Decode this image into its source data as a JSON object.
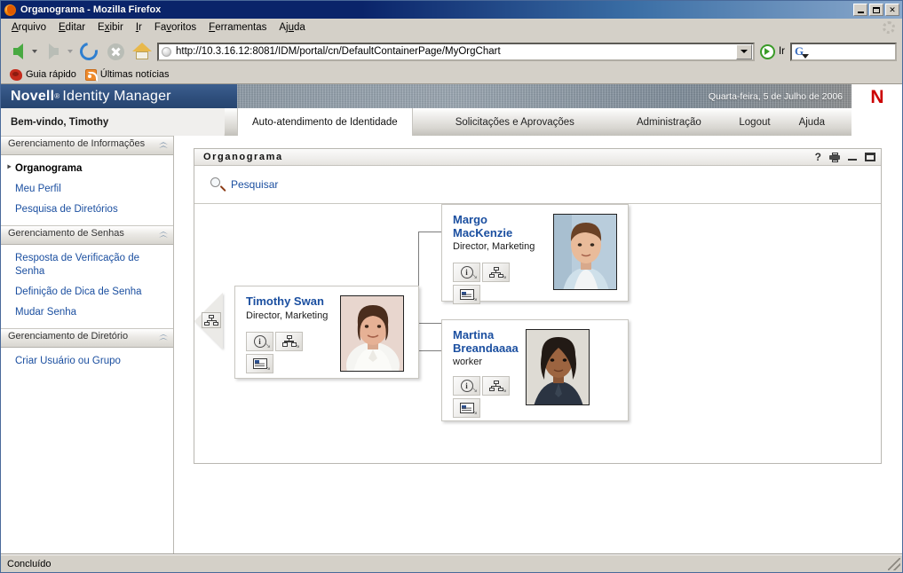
{
  "window": {
    "title": "Organograma - Mozilla Firefox",
    "app_icon": "firefox-icon",
    "minimize_label": "",
    "maximize_label": "",
    "close_label": "✕"
  },
  "menubar": {
    "items": [
      {
        "label": "Arquivo",
        "accel": "A"
      },
      {
        "label": "Editar",
        "accel": "E"
      },
      {
        "label": "Exibir",
        "accel": "x"
      },
      {
        "label": "Ir",
        "accel": "I"
      },
      {
        "label": "Favoritos",
        "accel": "v"
      },
      {
        "label": "Ferramentas",
        "accel": "F"
      },
      {
        "label": "Ajuda",
        "accel": "u"
      }
    ]
  },
  "toolbar": {
    "back_icon": "back-arrow-icon",
    "forward_icon": "forward-arrow-icon",
    "reload_icon": "reload-icon",
    "stop_icon": "stop-icon",
    "home_icon": "home-icon",
    "url": "http://10.3.16.12:8081/IDM/portal/cn/DefaultContainerPage/MyOrgChart",
    "url_placeholder": "",
    "go_label": "Ir",
    "search_value": "",
    "search_placeholder": "",
    "search_engine_icon": "google-g-icon"
  },
  "bookmarks": [
    {
      "label": "Guia rápido",
      "icon": "firefox-bookmark-icon"
    },
    {
      "label": "Últimas notícias",
      "icon": "rss-feed-icon"
    }
  ],
  "novell": {
    "brand_name": "Novell",
    "brand_reg": "®",
    "brand_product": "Identity Manager",
    "date": "Quarta-feira, 5 de Julho de 2006",
    "logo_letter": "N",
    "logo_color": "#cc0000",
    "welcome": "Bem-vindo, Timothy"
  },
  "tabs": [
    {
      "label": "Auto-atendimento de Identidade",
      "active": true
    },
    {
      "label": "Solicitações e Aprovações",
      "active": false
    },
    {
      "label": "Administração",
      "active": false
    },
    {
      "label": "Logout",
      "active": false
    },
    {
      "label": "Ajuda",
      "active": false
    }
  ],
  "sidebar": {
    "sections": [
      {
        "title": "Gerenciamento de Informações",
        "collapse_icon": "chevron-up-icon",
        "links": [
          {
            "label": "Organograma",
            "active": true
          },
          {
            "label": "Meu Perfil",
            "active": false
          },
          {
            "label": "Pesquisa de Diretórios",
            "active": false
          }
        ]
      },
      {
        "title": "Gerenciamento de Senhas",
        "collapse_icon": "chevron-up-icon",
        "links": [
          {
            "label": "Resposta de Verificação de Senha",
            "active": false
          },
          {
            "label": "Definição de Dica de Senha",
            "active": false
          },
          {
            "label": "Mudar Senha",
            "active": false
          }
        ]
      },
      {
        "title": "Gerenciamento de Diretório",
        "collapse_icon": "chevron-up-icon",
        "links": [
          {
            "label": "Criar Usuário ou Grupo",
            "active": false
          }
        ]
      }
    ]
  },
  "portlet": {
    "title": "Organograma",
    "controls": [
      {
        "name": "help-icon",
        "label": "?"
      },
      {
        "name": "print-icon",
        "label": ""
      },
      {
        "name": "minimize-icon",
        "label": ""
      },
      {
        "name": "maximize-icon",
        "label": ""
      }
    ],
    "search_icon": "magnifier-icon",
    "search_label": "Pesquisar"
  },
  "orgchart": {
    "up_icon": "org-chart-icon",
    "root": {
      "name": "Timothy Swan",
      "title": "Director, Marketing",
      "photo": "photo-timothy-swan",
      "actions": [
        {
          "name": "info-action",
          "icon": "info-icon"
        },
        {
          "name": "orgchart-action",
          "icon": "org-chart-icon"
        },
        {
          "name": "email-action",
          "icon": "email-card-icon"
        }
      ]
    },
    "children": [
      {
        "name": "Margo MacKenzie",
        "title": "Director, Marketing",
        "photo": "photo-margo-mackenzie",
        "actions": [
          {
            "name": "info-action",
            "icon": "info-icon"
          },
          {
            "name": "orgchart-action",
            "icon": "org-chart-icon"
          },
          {
            "name": "email-action",
            "icon": "email-card-icon"
          }
        ]
      },
      {
        "name": "Martina\nBreandaaaa",
        "title": "worker",
        "photo": "photo-martina-breandaaaa",
        "actions": [
          {
            "name": "info-action",
            "icon": "info-icon"
          },
          {
            "name": "orgchart-action",
            "icon": "org-chart-icon"
          },
          {
            "name": "email-action",
            "icon": "email-card-icon"
          }
        ]
      }
    ]
  },
  "statusbar": {
    "text": "Concluído"
  },
  "colors": {
    "link": "#1b4fa0",
    "novell_blue": "#2e4e7c",
    "novell_red": "#cc0000",
    "titlebar": "#0a246a"
  }
}
